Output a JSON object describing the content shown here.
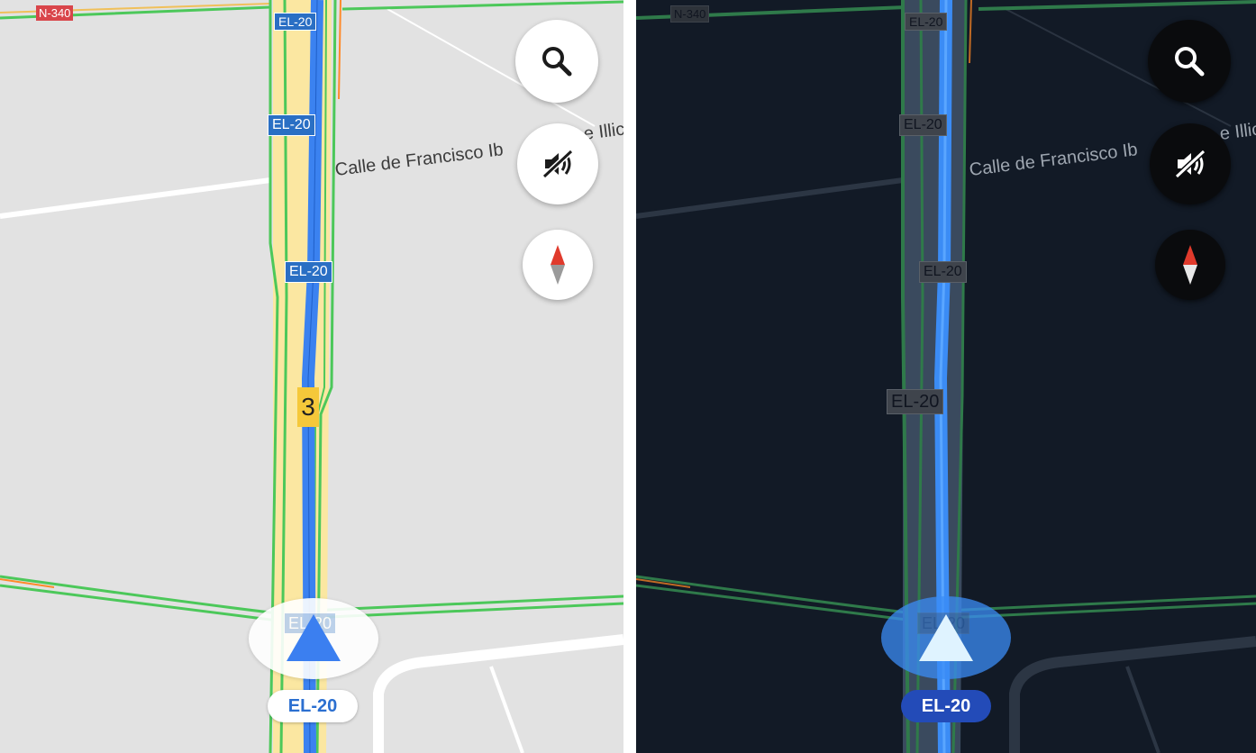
{
  "light_panel": {
    "road_shields": [
      "N-340",
      "EL-20",
      "EL-20",
      "EL-20",
      "EL-20"
    ],
    "lane_count": "3",
    "street_name": "Calle de Francisco Ib",
    "street_name_suffix": "e Illic",
    "current_road": "EL-20",
    "colors": {
      "route": "#3b82f0",
      "traffic_green": "#4cc85a",
      "map_bg": "#e2e2e2"
    }
  },
  "dark_panel": {
    "road_shields": [
      "N-340",
      "EL-20",
      "EL-20",
      "EL-20",
      "EL-20",
      "EL-20"
    ],
    "street_name": "Calle de Francisco Ib",
    "street_name_suffix": "e Illic",
    "current_road": "EL-20",
    "colors": {
      "route": "#3b8cf5",
      "traffic_green": "#2f7a4a",
      "map_bg": "#121a26"
    }
  },
  "icons": {
    "search": "search-icon",
    "mute": "volume-off-icon",
    "compass": "compass-icon",
    "navigation": "navigation-arrow-icon"
  }
}
